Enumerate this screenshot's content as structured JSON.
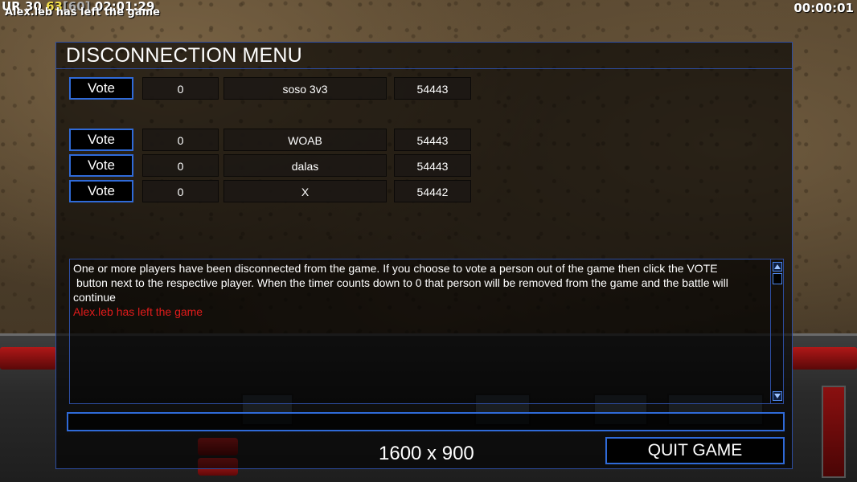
{
  "overlay": {
    "stats_prefix": "UR ",
    "stats_a": "30",
    "stats_b": "63",
    "stats_c": "[60]",
    "stats_time": "02:01:29",
    "left_message": "Alex.leb has left the game",
    "timer": "00:00:01"
  },
  "dialog": {
    "title": "DISCONNECTION MENU",
    "players_top": [
      {
        "vote_label": "Vote",
        "votes": "0",
        "name": "soso 3v3",
        "ping": "54443"
      }
    ],
    "players": [
      {
        "vote_label": "Vote",
        "votes": "0",
        "name": "WOAB",
        "ping": "54443"
      },
      {
        "vote_label": "Vote",
        "votes": "0",
        "name": "dalas",
        "ping": "54443"
      },
      {
        "vote_label": "Vote",
        "votes": "0",
        "name": "X",
        "ping": "54442"
      }
    ],
    "message_line1": "One or more players have been disconnected from the game. If you choose to vote a person out of the game then click the VOTE",
    "message_line2": "button next to the respective player. When the timer counts down to 0 that person will be removed from the game and the battle will",
    "message_line3": "continue",
    "message_red": "Alex.leb has left the game",
    "chat_value": "",
    "resolution": "1600 x 900",
    "quit_label": "QUIT GAME"
  },
  "colors": {
    "accent": "#2f6ad8",
    "alert": "#e01b1b",
    "stat_yellow": "#f4e04a"
  },
  "icons": [
    "scroll-up-arrow-icon",
    "scroll-down-arrow-icon"
  ]
}
